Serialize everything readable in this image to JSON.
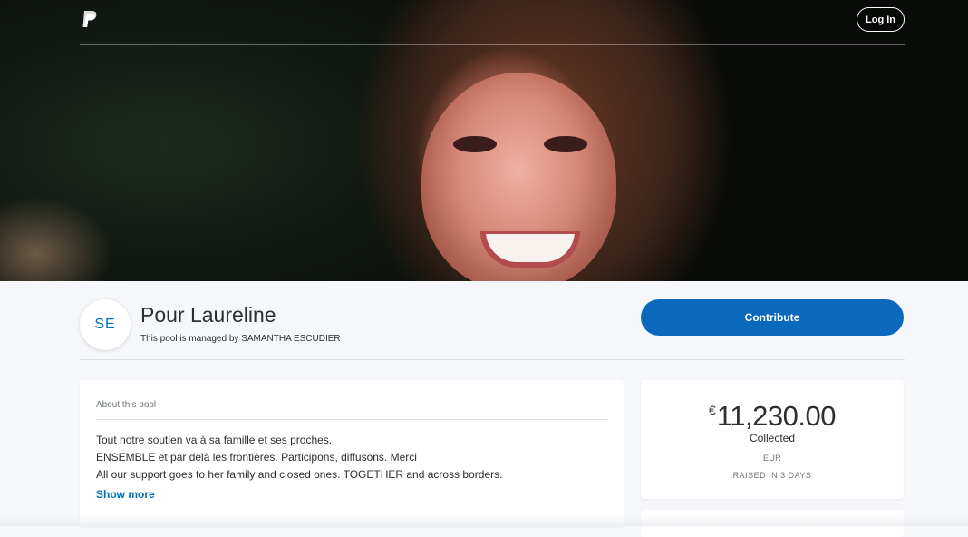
{
  "header": {
    "login_label": "Log In"
  },
  "pool": {
    "avatar_initials": "SE",
    "title": "Pour Laureline",
    "manager_text": "This pool is managed by SAMANTHA ESCUDIER",
    "contribute_label": "Contribute"
  },
  "about": {
    "heading": "About this pool",
    "lines": [
      "Tout notre soutien va à sa famille et ses proches.",
      "ENSEMBLE et par delà les frontières. Participons, diffusons. Merci",
      "All our support goes to her family and closed ones. TOGETHER and across borders."
    ],
    "show_more_label": "Show more"
  },
  "stats": {
    "currency_symbol": "€",
    "amount": "11,230.00",
    "collected_label": "Collected",
    "currency_code": "EUR",
    "raised_label": "RAISED IN 3 DAYS"
  },
  "colors": {
    "accent": "#0070ba",
    "button": "#0a69bd"
  },
  "icons": {
    "logo": "paypal-logo-icon"
  }
}
